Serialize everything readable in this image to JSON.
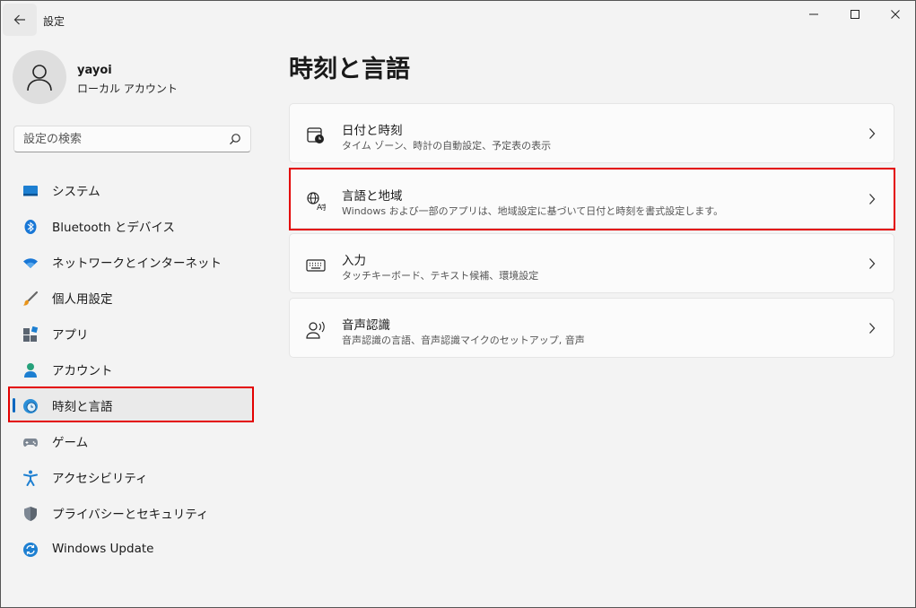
{
  "window": {
    "app_title": "設定",
    "controls": {
      "minimize": "minimize-icon",
      "maximize": "maximize-icon",
      "close": "close-icon"
    }
  },
  "profile": {
    "name": "yayoi",
    "account_type": "ローカル アカウント"
  },
  "search": {
    "placeholder": "設定の検索"
  },
  "sidebar": {
    "items": [
      {
        "label": "システム",
        "icon": "system-monitor-icon"
      },
      {
        "label": "Bluetooth とデバイス",
        "icon": "bluetooth-icon"
      },
      {
        "label": "ネットワークとインターネット",
        "icon": "wifi-icon"
      },
      {
        "label": "個人用設定",
        "icon": "brush-icon"
      },
      {
        "label": "アプリ",
        "icon": "apps-icon"
      },
      {
        "label": "アカウント",
        "icon": "person-icon"
      },
      {
        "label": "時刻と言語",
        "icon": "globe-clock-icon",
        "selected": true
      },
      {
        "label": "ゲーム",
        "icon": "gamepad-icon"
      },
      {
        "label": "アクセシビリティ",
        "icon": "accessibility-icon"
      },
      {
        "label": "プライバシーとセキュリティ",
        "icon": "shield-icon"
      },
      {
        "label": "Windows Update",
        "icon": "update-icon"
      }
    ]
  },
  "main": {
    "title": "時刻と言語",
    "cards": [
      {
        "title": "日付と時刻",
        "subtitle": "タイム ゾーン、時計の自動設定、予定表の表示",
        "icon": "calendar-clock-icon"
      },
      {
        "title": "言語と地域",
        "subtitle": "Windows および一部のアプリは、地域設定に基づいて日付と時刻を書式設定します。",
        "icon": "language-icon"
      },
      {
        "title": "入力",
        "subtitle": "タッチキーボード、テキスト候補、環境設定",
        "icon": "keyboard-icon"
      },
      {
        "title": "音声認識",
        "subtitle": "音声認識の言語、音声認識マイクのセットアップ, 音声",
        "icon": "speech-icon"
      }
    ]
  },
  "colors": {
    "accent": "#0067c0",
    "highlight": "#e30000",
    "background": "#f3f3f3",
    "card": "#fbfbfb"
  }
}
